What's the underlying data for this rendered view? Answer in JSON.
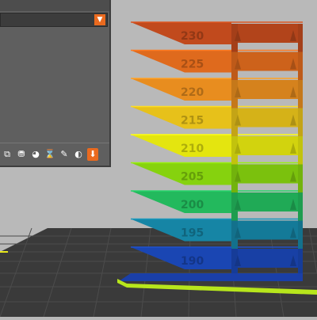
{
  "viewport": {
    "background": "#b9b9b9",
    "bed_color": "#3a3a3a",
    "grid_color": "#4c4c4c",
    "layer_colors": [
      "#c14a1d",
      "#df6a1d",
      "#e88d1f",
      "#e7c11a",
      "#e4e50f",
      "#86d20e",
      "#23b95d",
      "#1685a5",
      "#1a46b3"
    ],
    "layer_labels": [
      "230",
      "225",
      "220",
      "215",
      "210",
      "205",
      "200",
      "195",
      "190"
    ]
  },
  "panel": {
    "dropdown": {
      "value": ""
    },
    "toolbar": {
      "items": [
        {
          "icon": "link-icon",
          "glyph": "⧉"
        },
        {
          "icon": "support-icon",
          "glyph": "⛃"
        },
        {
          "icon": "color-icon",
          "glyph": "◕"
        },
        {
          "icon": "hourglass-icon",
          "glyph": "⌛"
        },
        {
          "icon": "brush-icon",
          "glyph": "✎"
        },
        {
          "icon": "seam-icon",
          "glyph": "◐"
        },
        {
          "icon": "arrow-down-icon",
          "glyph": "⬇",
          "active": true
        }
      ]
    }
  }
}
